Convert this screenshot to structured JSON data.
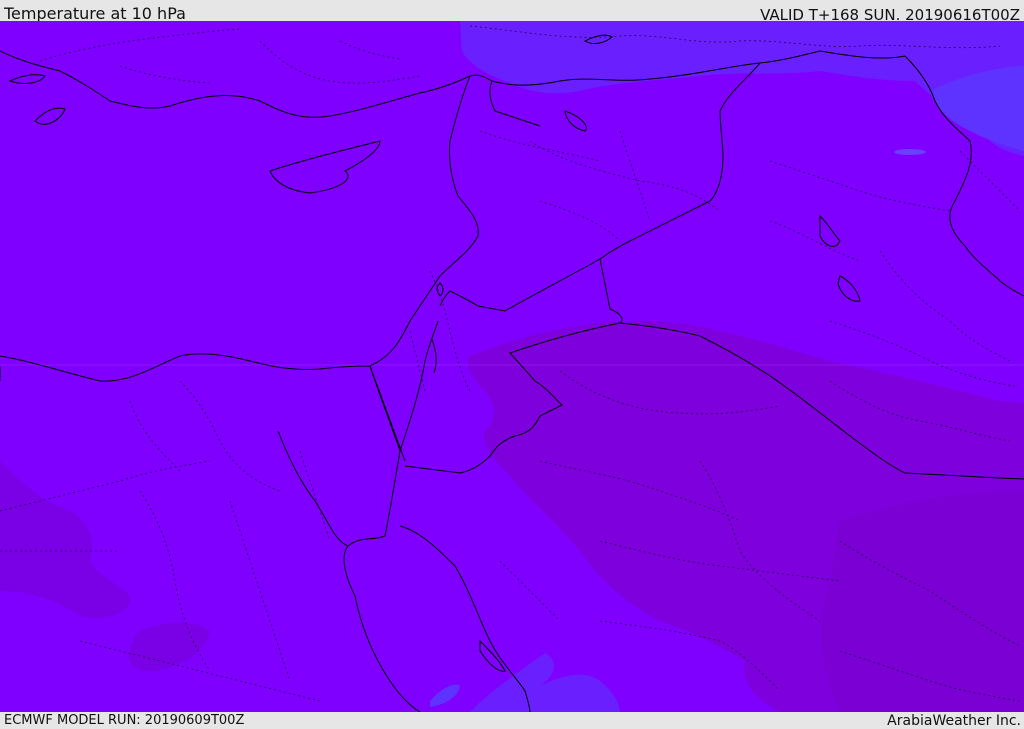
{
  "header": {
    "title": "Temperature at 10 hPa",
    "valid_time": "VALID T+168 SUN. 20190616T00Z"
  },
  "footer": {
    "model_run": "ECMWF MODEL RUN: 20190609T00Z",
    "provider": "ArabiaWeather Inc."
  },
  "map": {
    "region": "Eastern Mediterranean / Middle East",
    "parameter": "Temperature",
    "level": "10 hPa",
    "colors": {
      "field_base": "#7f00ff",
      "field_warm": "#7e00dc",
      "field_warmer": "#7800cf",
      "field_cool": "#6a1fff",
      "field_cooler": "#5f33ff",
      "border_line": "#000000"
    }
  }
}
